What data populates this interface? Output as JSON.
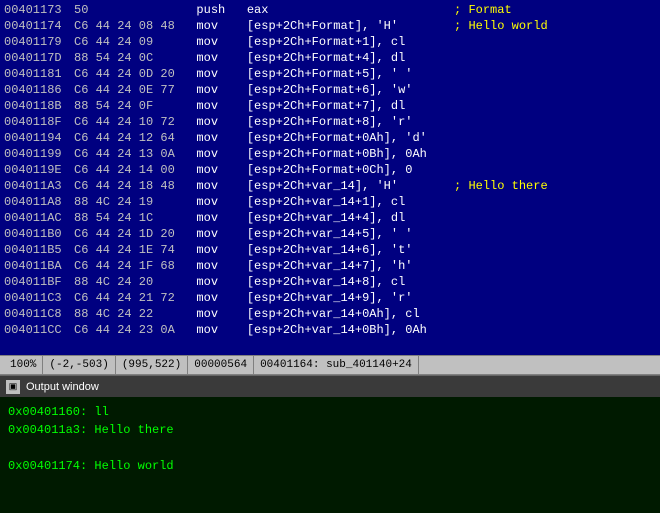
{
  "disasm": {
    "lines": [
      {
        "addr": "00401173",
        "bytes": "50",
        "mnemonic": "push",
        "operands": "eax",
        "comment": "; Format"
      },
      {
        "addr": "00401174",
        "bytes": "C6 44 24 08 48",
        "mnemonic": "mov",
        "operands": "[esp+2Ch+Format], 'H'",
        "comment": "; Hello world"
      },
      {
        "addr": "00401179",
        "bytes": "C6 44 24 09",
        "mnemonic": "mov",
        "operands": "[esp+2Ch+Format+1], cl",
        "comment": ""
      },
      {
        "addr": "0040117D",
        "bytes": "88 54 24 0C",
        "mnemonic": "mov",
        "operands": "[esp+2Ch+Format+4], dl",
        "comment": ""
      },
      {
        "addr": "00401181",
        "bytes": "C6 44 24 0D 20",
        "mnemonic": "mov",
        "operands": "[esp+2Ch+Format+5], ' '",
        "comment": ""
      },
      {
        "addr": "00401186",
        "bytes": "C6 44 24 0E 77",
        "mnemonic": "mov",
        "operands": "[esp+2Ch+Format+6], 'w'",
        "comment": ""
      },
      {
        "addr": "0040118B",
        "bytes": "88 54 24 0F",
        "mnemonic": "mov",
        "operands": "[esp+2Ch+Format+7], dl",
        "comment": ""
      },
      {
        "addr": "0040118F",
        "bytes": "C6 44 24 10 72",
        "mnemonic": "mov",
        "operands": "[esp+2Ch+Format+8], 'r'",
        "comment": ""
      },
      {
        "addr": "00401194",
        "bytes": "C6 44 24 12 64",
        "mnemonic": "mov",
        "operands": "[esp+2Ch+Format+0Ah], 'd'",
        "comment": ""
      },
      {
        "addr": "00401199",
        "bytes": "C6 44 24 13 0A",
        "mnemonic": "mov",
        "operands": "[esp+2Ch+Format+0Bh], 0Ah",
        "comment": ""
      },
      {
        "addr": "0040119E",
        "bytes": "C6 44 24 14 00",
        "mnemonic": "mov",
        "operands": "[esp+2Ch+Format+0Ch], 0",
        "comment": ""
      },
      {
        "addr": "004011A3",
        "bytes": "C6 44 24 18 48",
        "mnemonic": "mov",
        "operands": "[esp+2Ch+var_14], 'H'",
        "comment": "; Hello there"
      },
      {
        "addr": "004011A8",
        "bytes": "88 4C 24 19",
        "mnemonic": "mov",
        "operands": "[esp+2Ch+var_14+1], cl",
        "comment": ""
      },
      {
        "addr": "004011AC",
        "bytes": "88 54 24 1C",
        "mnemonic": "mov",
        "operands": "[esp+2Ch+var_14+4], dl",
        "comment": ""
      },
      {
        "addr": "004011B0",
        "bytes": "C6 44 24 1D 20",
        "mnemonic": "mov",
        "operands": "[esp+2Ch+var_14+5], ' '",
        "comment": ""
      },
      {
        "addr": "004011B5",
        "bytes": "C6 44 24 1E 74",
        "mnemonic": "mov",
        "operands": "[esp+2Ch+var_14+6], 't'",
        "comment": ""
      },
      {
        "addr": "004011BA",
        "bytes": "C6 44 24 1F 68",
        "mnemonic": "mov",
        "operands": "[esp+2Ch+var_14+7], 'h'",
        "comment": ""
      },
      {
        "addr": "004011BF",
        "bytes": "88 4C 24 20",
        "mnemonic": "mov",
        "operands": "[esp+2Ch+var_14+8], cl",
        "comment": ""
      },
      {
        "addr": "004011C3",
        "bytes": "C6 44 24 21 72",
        "mnemonic": "mov",
        "operands": "[esp+2Ch+var_14+9], 'r'",
        "comment": ""
      },
      {
        "addr": "004011C8",
        "bytes": "88 4C 24 22",
        "mnemonic": "mov",
        "operands": "[esp+2Ch+var_14+0Ah], cl",
        "comment": ""
      },
      {
        "addr": "004011CC",
        "bytes": "C6 44 24 23 0A",
        "mnemonic": "mov",
        "operands": "[esp+2Ch+var_14+0Bh], 0Ah",
        "comment": ""
      }
    ]
  },
  "statusbar": {
    "zoom": "100%",
    "coords": "(-2,-503)",
    "offset": "(995,522)",
    "hex": "00000564",
    "info": "00401164: sub_401140+24"
  },
  "output": {
    "title": "Output window",
    "lines": [
      "0x00401160: ll",
      "0x004011a3: Hello there",
      "",
      "0x00401174: Hello world"
    ]
  }
}
